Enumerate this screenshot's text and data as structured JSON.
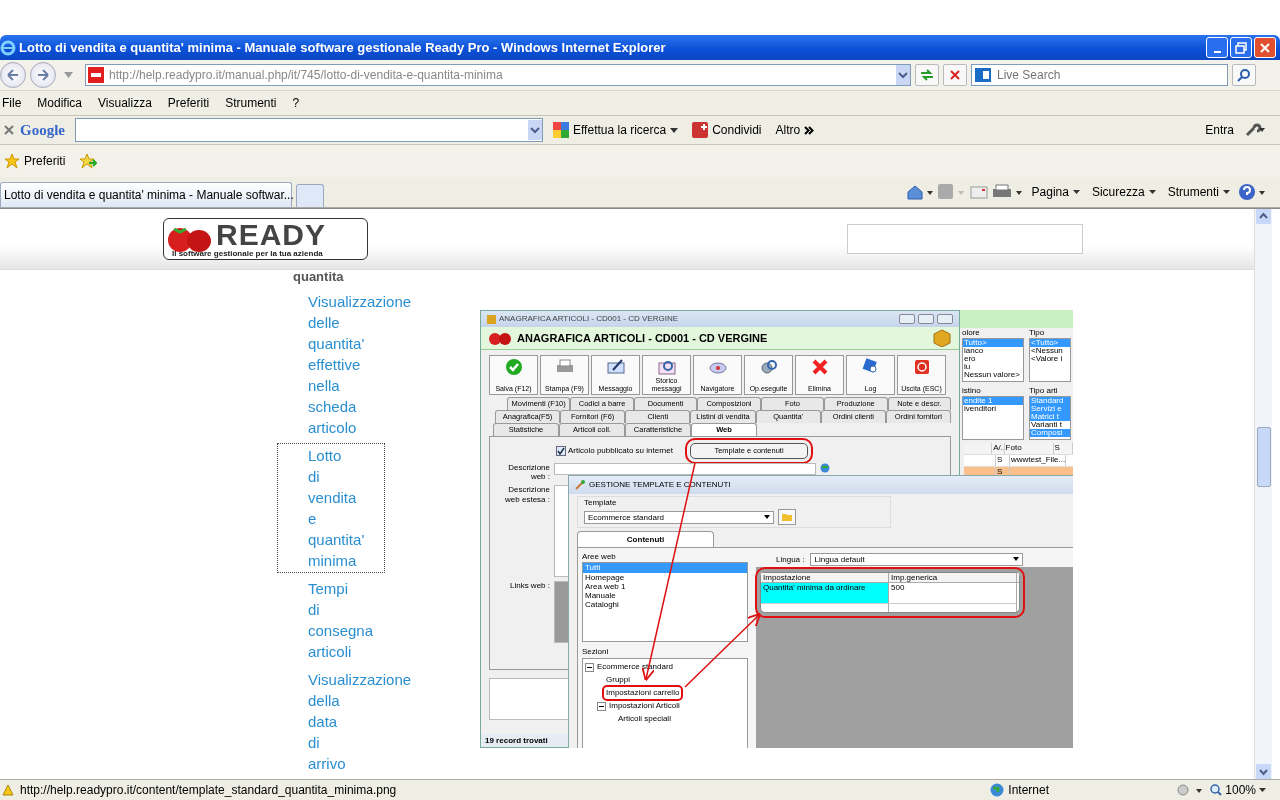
{
  "window": {
    "title": "Lotto di vendita e quantita' minima - Manuale software gestionale Ready Pro - Windows Internet Explorer"
  },
  "address_bar": {
    "url": "http://help.readypro.it/manual.php/it/745/lotto-di-vendita-e-quantita-minima"
  },
  "search": {
    "placeholder": "Live Search"
  },
  "menu": [
    "File",
    "Modifica",
    "Visualizza",
    "Preferiti",
    "Strumenti",
    "?"
  ],
  "google_toolbar": {
    "logo": "Google",
    "search_button": "Effettua la ricerca",
    "share_button": "Condividi",
    "more_button": "Altro",
    "sign_in": "Entra"
  },
  "favorites": {
    "label": "Preferiti"
  },
  "tabs": [
    {
      "label": "Lotto di vendita e quantita' minima - Manuale softwar...",
      "selected": true
    }
  ],
  "command_bar": [
    "Pagina",
    "Sicurezza",
    "Strumenti"
  ],
  "page": {
    "logo": {
      "brand": "READY",
      "tagline": "Il software gestionale per la tua azienda"
    },
    "heading": "quantita",
    "nav": [
      {
        "label": "Visualizzazione delle quantita' effettive nella scheda articolo",
        "selected": false
      },
      {
        "label": "Lotto di vendita e quantita' minima",
        "selected": true
      },
      {
        "label": "Tempi di consegna articoli",
        "selected": false
      },
      {
        "label": "Visualizzazione della data di arrivo",
        "selected": false
      }
    ],
    "screenshot": {
      "main_window": {
        "caption": "ANAGRAFICA ARTICOLI - CD001 - CD VERGINE",
        "title": "ANAGRAFICA ARTICOLI - CD001 - CD VERGINE",
        "toolbar": [
          {
            "label": "Salva (F12)",
            "kind": "save"
          },
          {
            "label": "Stampa (F9)",
            "kind": "print"
          },
          {
            "label": "Messaggio",
            "kind": "message"
          },
          {
            "label": "Storico messaggi",
            "kind": "history"
          },
          {
            "label": "Navigatore",
            "kind": "navigator"
          },
          {
            "label": "Op.eseguite",
            "kind": "tasks"
          },
          {
            "label": "Elimina",
            "kind": "delete"
          },
          {
            "label": "Log",
            "kind": "log"
          },
          {
            "label": "Uscita (ESC)",
            "kind": "exit"
          }
        ],
        "tab_rows": [
          [
            {
              "label": "Movimenti (F10)",
              "selected": false
            },
            {
              "label": "Codici a barre",
              "selected": false
            },
            {
              "label": "Documenti",
              "selected": false
            },
            {
              "label": "Composizioni",
              "selected": false
            },
            {
              "label": "Foto",
              "selected": false
            },
            {
              "label": "Produzione",
              "selected": false
            },
            {
              "label": "Note e descr.",
              "selected": false
            }
          ],
          [
            {
              "label": "Anagrafica(F5)",
              "selected": false
            },
            {
              "label": "Fornitori (F6)",
              "selected": false
            },
            {
              "label": "Clienti",
              "selected": false
            },
            {
              "label": "Listini di vendita",
              "selected": false
            },
            {
              "label": "Quantita'",
              "selected": false
            },
            {
              "label": "Ordini clienti",
              "selected": false
            },
            {
              "label": "Ordini fornitori",
              "selected": false
            }
          ],
          [
            {
              "label": "Statistiche",
              "selected": false
            },
            {
              "label": "Articoli coll.",
              "selected": false
            },
            {
              "label": "Caratteristiche",
              "selected": false
            },
            {
              "label": "Web",
              "selected": true
            }
          ]
        ],
        "published": {
          "label": "Articolo pubblicato su internet",
          "checked": true
        },
        "template_button": {
          "label": "Template e contenuti",
          "highlighted": true
        },
        "web_description_label": "Descrizione web :",
        "web_extended_label": "Descrizione web estesa :",
        "links_label": "Links web :",
        "record_count": "19 record trovati"
      },
      "filters": {
        "lists": [
          {
            "label": "olore",
            "items": [
              {
                "label": "Tutto>",
                "selected": true
              },
              {
                "label": "ianco",
                "selected": false
              },
              {
                "label": "ero",
                "selected": false
              },
              {
                "label": "lu",
                "selected": false
              },
              {
                "label": "Nessun valore>",
                "selected": false
              }
            ]
          },
          {
            "label": "Tipo",
            "items": [
              {
                "label": "<Tutto>",
                "selected": true
              },
              {
                "label": "<Nessun",
                "selected": false
              },
              {
                "label": "<Valore i",
                "selected": false
              }
            ]
          },
          {
            "label": "istino",
            "items": [
              {
                "label": "endite 1",
                "selected": true
              },
              {
                "label": "ivenditori",
                "selected": false
              }
            ]
          },
          {
            "label": "Tipo arti",
            "items": [
              {
                "label": "Standard",
                "selected": true
              },
              {
                "label": "Servizi e",
                "selected": true
              },
              {
                "label": "Matrici t",
                "selected": true
              },
              {
                "label": "Varianti t",
                "selected": false
              },
              {
                "label": "Composi",
                "selected": true
              }
            ]
          }
        ],
        "grid": {
          "columns": [
            "A/..",
            "Foto",
            "S"
          ],
          "rows": [
            {
              "cells": [
                "S",
                "wwwtest_File..."
              ],
              "selected": false
            },
            {
              "cells": [
                "S"
              ],
              "selected": true
            }
          ]
        }
      },
      "dialog": {
        "title": "GESTIONE TEMPLATE E CONTENUTI",
        "template_label": "Template",
        "template_value": "Ecommerce standard",
        "tab": "Contenuti",
        "areas_label": "Aree web",
        "areas": [
          {
            "label": "Tutti",
            "selected": true
          },
          {
            "label": "Homepage",
            "selected": false
          },
          {
            "label": "Area web 1",
            "selected": false
          },
          {
            "label": "Manuale",
            "selected": false
          },
          {
            "label": "Cataloghi",
            "selected": false
          }
        ],
        "sections_label": "Sezioni",
        "sections": [
          {
            "label": "Ecommerce standard",
            "expanded": true,
            "children": [
              {
                "label": "Gruppi",
                "highlighted": false
              },
              {
                "label": "Impostazioni carrello",
                "highlighted": true
              },
              {
                "label": "Impostazioni Articoli",
                "expanded": true,
                "children": [
                  {
                    "label": "Articoli speciali"
                  }
                ]
              }
            ]
          }
        ],
        "language_label": "Lingua :",
        "language_value": "Lingua default",
        "grid": {
          "highlighted": true,
          "columns": [
            "Impostazione",
            "Imp.generica"
          ],
          "rows": [
            {
              "cells": [
                "Quantita' minima da ordinare",
                "500"
              ],
              "selected": true
            }
          ]
        }
      }
    }
  },
  "status_bar": {
    "url": "http://help.readypro.it/content/template_standard_quantita_minima.png",
    "zone": "Internet",
    "zoom": "100%"
  }
}
